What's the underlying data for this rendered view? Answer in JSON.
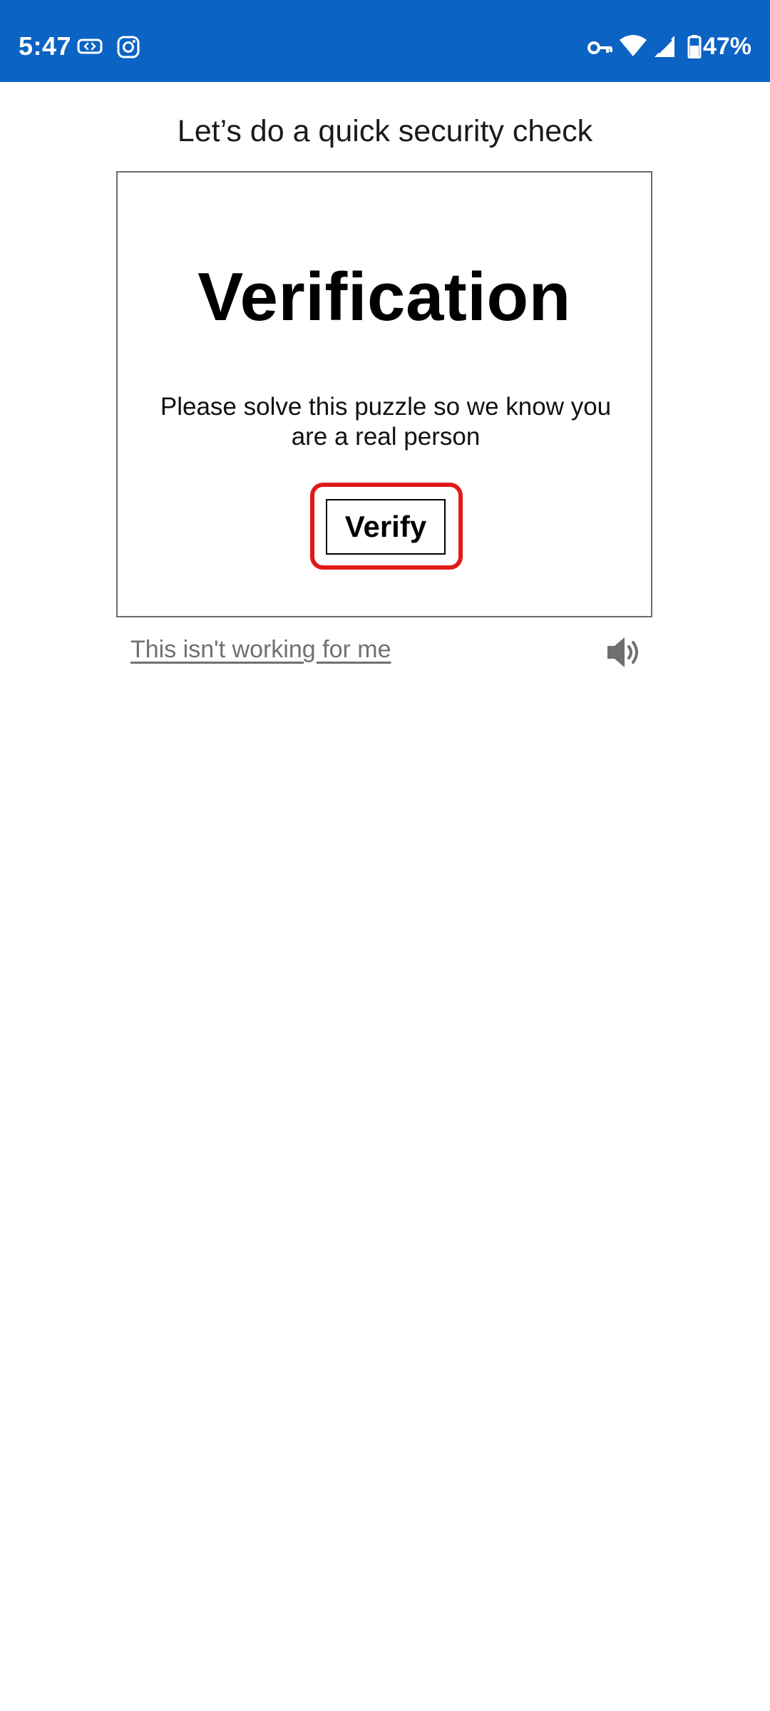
{
  "status_bar": {
    "time": "5:47",
    "battery": "47%",
    "background_color": "#0b63c4",
    "left_icons": [
      "vpn-tunnel-icon",
      "instagram-icon"
    ],
    "right_icons": [
      "key-icon",
      "wifi-icon",
      "cell-signal-icon",
      "battery-icon"
    ]
  },
  "page": {
    "heading": "Let’s do a quick security check"
  },
  "challenge": {
    "title": "Verification",
    "description": "Please solve this puzzle so we know you are a real person",
    "verify_label": "Verify",
    "focus_ring_color": "#e01a1a"
  },
  "footer": {
    "help_link": "This isn't working for me",
    "audio_icon": "speaker-audio-icon"
  }
}
